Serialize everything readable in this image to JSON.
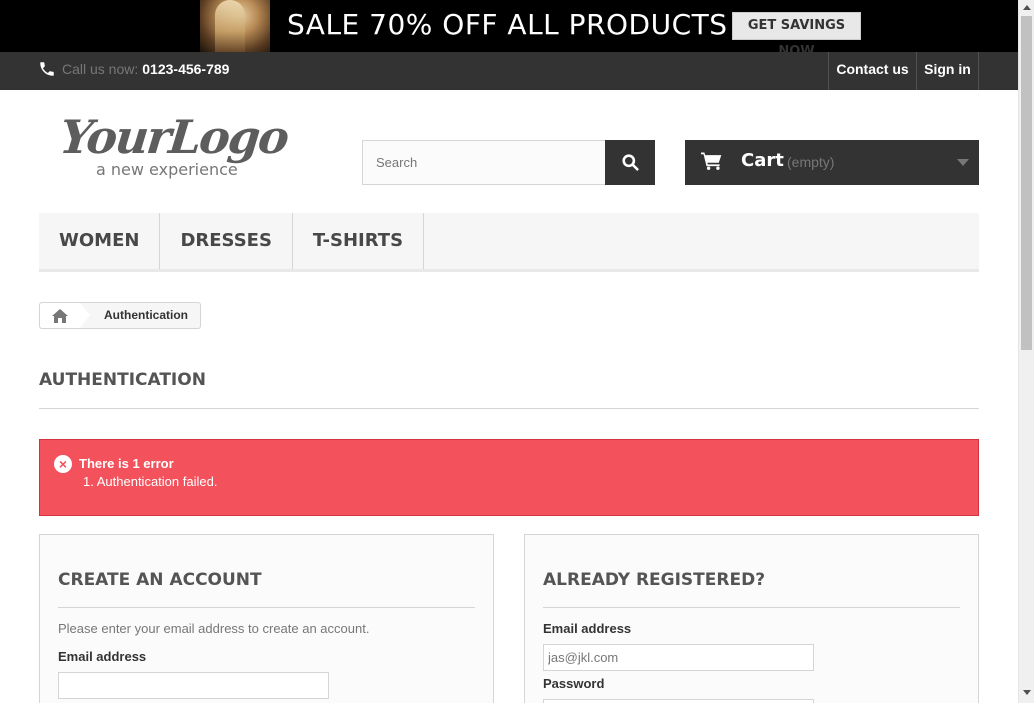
{
  "banner": {
    "sale_text": "SALE 70% OFF ALL PRODUCTS",
    "cta_label": "GET SAVINGS NOW"
  },
  "topnav": {
    "call_label": "Call us now:",
    "phone_number": "0123-456-789",
    "contact_label": "Contact us",
    "signin_label": "Sign in"
  },
  "header": {
    "logo_main": "YourLogo",
    "logo_sub": "a new experience",
    "search_placeholder": "Search",
    "cart_label": "Cart",
    "cart_status": "(empty)"
  },
  "menu": {
    "items": [
      {
        "label": "WOMEN"
      },
      {
        "label": "DRESSES"
      },
      {
        "label": "T-SHIRTS"
      }
    ]
  },
  "breadcrumb": {
    "current": "Authentication"
  },
  "page_heading": "AUTHENTICATION",
  "alert": {
    "icon": "×",
    "title": "There is 1 error",
    "items": [
      "1. Authentication failed."
    ]
  },
  "create_account": {
    "title": "CREATE AN ACCOUNT",
    "description": "Please enter your email address to create an account.",
    "email_label": "Email address",
    "email_value": ""
  },
  "login": {
    "title": "ALREADY REGISTERED?",
    "email_label": "Email address",
    "email_value": "jas@jkl.com",
    "password_label": "Password",
    "password_value": ""
  },
  "colors": {
    "dark": "#333333",
    "alert_bg": "#f3515c",
    "menu_bg": "#f6f6f6",
    "border": "#d6d4d4"
  }
}
